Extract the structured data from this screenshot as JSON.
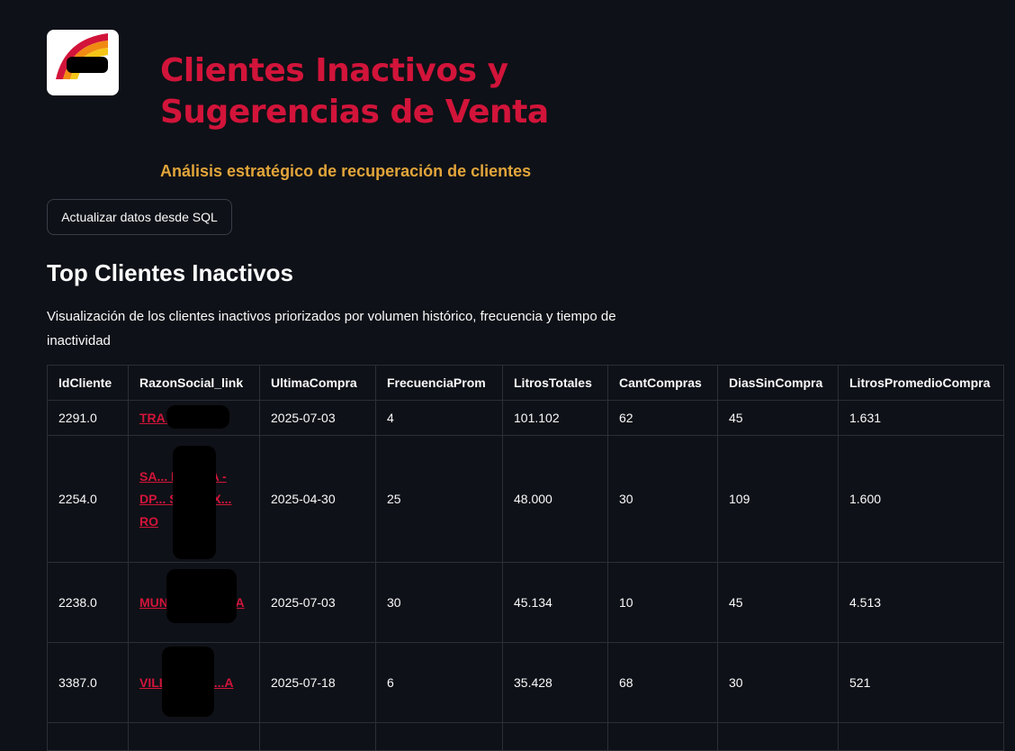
{
  "header": {
    "logo_icon": "company-logo",
    "title": "Clientes Inactivos y Sugerencias de Venta",
    "subtitle": "Análisis estratégico de recuperación de clientes"
  },
  "actions": {
    "refresh_label": "Actualizar datos desde SQL"
  },
  "section": {
    "title": "Top Clientes Inactivos",
    "description": "Visualización de los clientes inactivos priorizados por volumen histórico, frecuencia y tiempo de inactividad"
  },
  "table": {
    "columns": [
      "IdCliente",
      "RazonSocial_link",
      "UltimaCompra",
      "FrecuenciaProm",
      "LitrosTotales",
      "CantCompras",
      "DiasSinCompra",
      "LitrosPromedioCompra"
    ],
    "rows": [
      {
        "id": "2291.0",
        "razon": "TRA... S.A.",
        "ultima": "2025-07-03",
        "frec": "4",
        "litros": "101.102",
        "cant": "62",
        "dias": "45",
        "prom": "1.631"
      },
      {
        "id": "2254.0",
        "razon": "SA... PE... SA - DP... SIN... EX... RO",
        "ultima": "2025-04-30",
        "frec": "25",
        "litros": "48.000",
        "cant": "30",
        "dias": "109",
        "prom": "1.600"
      },
      {
        "id": "2238.0",
        "razon": "MUNI... DE... MZA",
        "ultima": "2025-07-03",
        "frec": "30",
        "litros": "45.134",
        "cant": "10",
        "dias": "45",
        "prom": "4.513"
      },
      {
        "id": "3387.0",
        "razon": "VILL... M... A...A",
        "ultima": "2025-07-18",
        "frec": "6",
        "litros": "35.428",
        "cant": "68",
        "dias": "30",
        "prom": "521"
      }
    ]
  },
  "colors": {
    "background": "#0e1117",
    "title": "#d2143a",
    "subtitle": "#e2a53a",
    "link": "#d2143a"
  }
}
